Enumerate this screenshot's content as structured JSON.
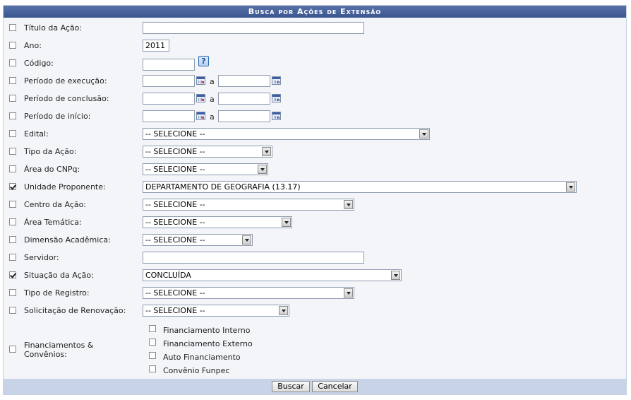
{
  "form": {
    "caption": "Busca por Ações de Extensão",
    "fields": {
      "titulo": {
        "label": "Título da Ação:",
        "value": "",
        "checked": false
      },
      "ano": {
        "label": "Ano:",
        "value": "2011",
        "checked": false
      },
      "codigo": {
        "label": "Código:",
        "value": "",
        "help_glyph": "?",
        "checked": false
      },
      "periodo_execucao": {
        "label": "Período de execução:",
        "from": "",
        "to": "",
        "separator": "a",
        "checked": false
      },
      "periodo_conclusao": {
        "label": "Período de conclusão:",
        "from": "",
        "to": "",
        "separator": "a",
        "checked": false
      },
      "periodo_inicio": {
        "label": "Período de início:",
        "from": "",
        "to": "",
        "separator": "a",
        "checked": false
      },
      "edital": {
        "label": "Edital:",
        "selected": "-- SELECIONE --",
        "checked": false
      },
      "tipo_acao": {
        "label": "Tipo da Ação:",
        "selected": "-- SELECIONE --",
        "checked": false
      },
      "area_cnpq": {
        "label": "Área do CNPq:",
        "selected": "-- SELECIONE --",
        "checked": false
      },
      "unidade_proponente": {
        "label": "Unidade Proponente:",
        "selected": "DEPARTAMENTO DE GEOGRAFIA (13.17)",
        "checked": true
      },
      "centro_acao": {
        "label": "Centro da Ação:",
        "selected": "-- SELECIONE --",
        "checked": false
      },
      "area_tematica": {
        "label": "Área Temática:",
        "selected": "-- SELECIONE --",
        "checked": false
      },
      "dimensao_academica": {
        "label": "Dimensão Acadêmica:",
        "selected": "-- SELECIONE --",
        "checked": false
      },
      "servidor": {
        "label": "Servidor:",
        "value": "",
        "checked": false
      },
      "situacao_acao": {
        "label": "Situação da Ação:",
        "selected": "CONCLUÍDA",
        "checked": true
      },
      "tipo_registro": {
        "label": "Tipo de Registro:",
        "selected": "-- SELECIONE --",
        "checked": false
      },
      "solicitacao_renovacao": {
        "label": "Solicitação de Renovação:",
        "selected": "-- SELECIONE --",
        "checked": false
      },
      "financiamentos": {
        "label": "Financiamentos & Convênios:",
        "checked": false,
        "options": [
          "Financiamento Interno",
          "Financiamento Externo",
          "Auto Financiamento",
          "Convênio Funpec"
        ]
      }
    },
    "buttons": {
      "buscar": "Buscar",
      "cancelar": "Cancelar"
    }
  }
}
